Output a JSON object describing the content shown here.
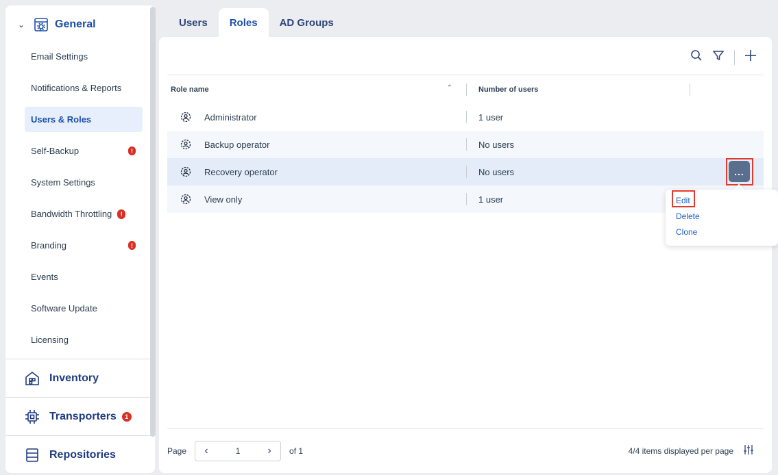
{
  "sidebar": {
    "general": {
      "title": "General"
    },
    "items": [
      {
        "label": "Email Settings"
      },
      {
        "label": "Notifications & Reports"
      },
      {
        "label": "Users & Roles"
      },
      {
        "label": "Self-Backup",
        "badge": "!"
      },
      {
        "label": "System Settings"
      },
      {
        "label": "Bandwidth Throttling",
        "badge": "!"
      },
      {
        "label": "Branding",
        "badge": "!"
      },
      {
        "label": "Events"
      },
      {
        "label": "Software Update"
      },
      {
        "label": "Licensing"
      }
    ],
    "sections": [
      {
        "title": "Inventory"
      },
      {
        "title": "Transporters",
        "badge": "1"
      },
      {
        "title": "Repositories"
      }
    ]
  },
  "tabs": [
    {
      "label": "Users"
    },
    {
      "label": "Roles"
    },
    {
      "label": "AD Groups"
    }
  ],
  "table": {
    "headers": {
      "role": "Role name",
      "users": "Number of users"
    },
    "rows": [
      {
        "name": "Administrator",
        "users": "1 user"
      },
      {
        "name": "Backup operator",
        "users": "No users"
      },
      {
        "name": "Recovery operator",
        "users": "No users"
      },
      {
        "name": "View only",
        "users": "1 user"
      }
    ]
  },
  "row_menu": {
    "button": "...",
    "items": [
      {
        "label": "Edit"
      },
      {
        "label": "Delete"
      },
      {
        "label": "Clone"
      }
    ]
  },
  "footer": {
    "page_label": "Page",
    "page": "1",
    "of": "of 1",
    "items_info": "4/4 items displayed per page"
  },
  "colors": {
    "accent": "#1c4fa8",
    "highlight": "#e03c2e",
    "badge": "#d93025"
  }
}
